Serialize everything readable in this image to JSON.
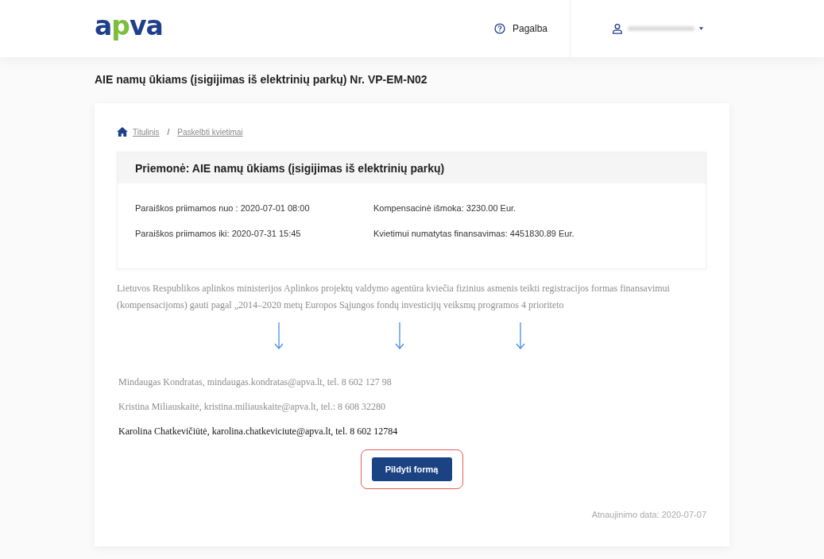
{
  "header": {
    "logo": "apva",
    "help": "Pagalba"
  },
  "page_title": "AIE namų ūkiams (įsigijimas iš elektrinių parkų) Nr. VP-EM-N02",
  "breadcrumbs": [
    "Titulinis",
    "Paskelbti kvietimai"
  ],
  "breadcrumb_separator": "/",
  "info": {
    "title": "Priemonė: AIE namų ūkiams (įsigijimas iš elektrinių parkų)",
    "fields": [
      "Paraiškos priimamos nuo : 2020-07-01 08:00",
      "Kompensacinė išmoka: 3230.00 Eur.",
      "Paraiškos priimamos iki: 2020-07-31 15:45",
      "Kvietimui numatytas finansavimas: 4451830.89 Eur."
    ]
  },
  "description": [
    {
      "text": "Lietuvos Respublikos aplinkos ministerijos Aplinkos projektų valdymo agentūra kviečia fizinius asmenis teikti registracijos formas finansavimui",
      "muted": true
    },
    {
      "text": "(kompensacijoms) gauti pagal „2014–2020 metų Europos Sąjungos fondų investicijų veiksmų programos 4 prioriteto",
      "muted": true
    }
  ],
  "contacts": [
    {
      "text": "Mindaugas Kondratas, mindaugas.kondratas@apva.lt, tel. 8 602 127 98",
      "muted": true
    },
    {
      "text": "Kristina Miliauskaitė, kristina.miliauskaite@apva.lt, tel.: 8 608 32280",
      "muted": true
    },
    {
      "text": "Karolina Chatkevičiūtė, karolina.chatkeviciute@apva.lt, tel. 8 602 12784",
      "muted": false
    }
  ],
  "fill_button": {
    "label": "Pildyti formą",
    "highlighted": true
  },
  "updated": "Atnaujinimo data: 2020-07-07"
}
